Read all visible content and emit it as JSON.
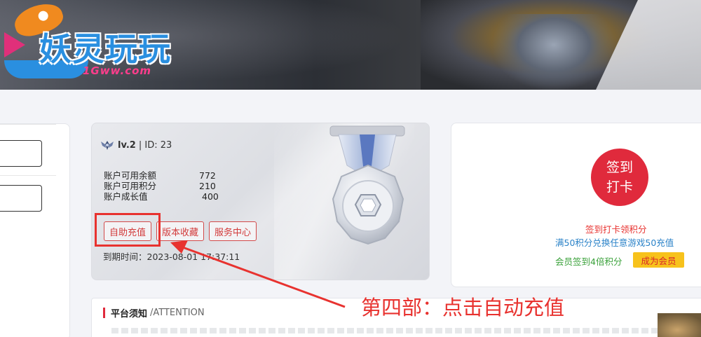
{
  "banner": {
    "logo_title": "妖灵玩玩",
    "logo_sub": "1Gww.com"
  },
  "account": {
    "level_text": "lv.2",
    "id_text": "| ID: 23",
    "stats": [
      {
        "label": "账户可用余额",
        "value": "772"
      },
      {
        "label": "账户可用积分",
        "value": "210"
      },
      {
        "label": "账户成长值",
        "value": "400"
      }
    ],
    "buttons": {
      "auto_recharge": "自助充值",
      "favorite": "版本收藏",
      "service": "服务中心"
    },
    "expire_text": "到期时间：2023-08-01 17:37:11"
  },
  "signin": {
    "line1": "签到",
    "line2": "打卡",
    "info1": "签到打卡领积分",
    "info2": "满50积分兑换任意游戏50充值",
    "info3": "会员签到4倍积分",
    "vip_button": "成为会员"
  },
  "notice": {
    "title": "平台须知",
    "title_en": "/ATTENTION"
  },
  "annotation": {
    "text": "第四部：点击自动充值"
  }
}
